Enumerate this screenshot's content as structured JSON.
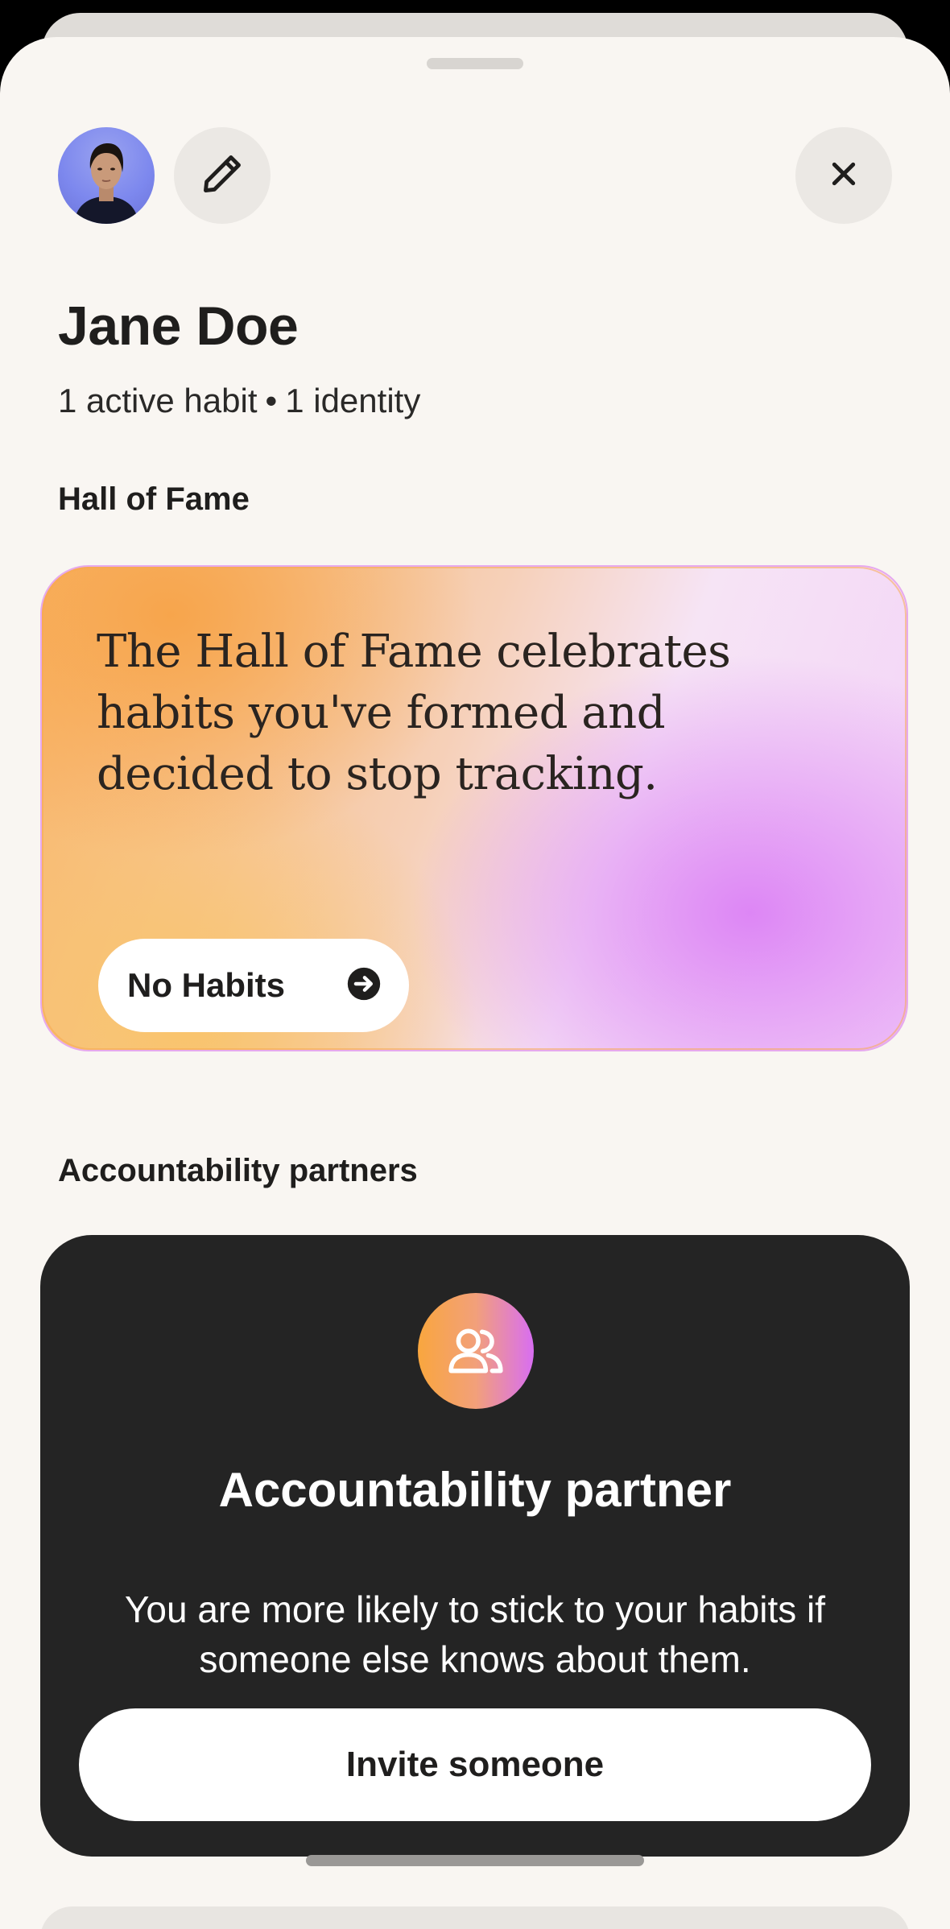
{
  "profile": {
    "name": "Jane Doe",
    "active_habits": "1 active habit",
    "separator": "•",
    "identities": "1 identity"
  },
  "hall_of_fame": {
    "section_title": "Hall of Fame",
    "description": "The Hall of Fame celebrates habits you've formed and decided to stop tracking.",
    "button_label": "No Habits"
  },
  "partners": {
    "section_title": "Accountability partners",
    "card_title": "Accountability partner",
    "card_description": "You are more likely to stick to your habits if someone else knows about them.",
    "invite_label": "Invite someone"
  },
  "icons": {
    "edit": "pencil-icon",
    "close": "close-icon",
    "arrow": "arrow-right-circle-icon",
    "partners": "users-icon"
  },
  "colors": {
    "background": "#f9f6f2",
    "text": "#1f1e1d",
    "dark_card": "#242424",
    "orange": "#f9a63e",
    "purple": "#d86ef2"
  }
}
